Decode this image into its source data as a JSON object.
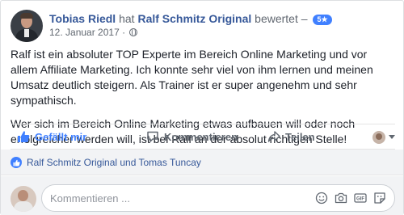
{
  "post": {
    "author": "Tobias Riedl",
    "verb": "hat",
    "page": "Ralf Schmitz Original",
    "action": "bewertet",
    "dash": "–",
    "rating": "5★",
    "date": "12. Januar 2017 ·",
    "privacy_icon": "globe-icon",
    "paragraph1": "Ralf ist ein absoluter TOP Experte im Bereich Online Marketing und vor allem Affiliate Marketing. Ich konnte sehr viel von ihm lernen und meinen Umsatz deutlich steigern. Als Trainer ist er super angenehm und sehr sympathisch.",
    "paragraph2": "Wer sich im Bereich Online Marketing etwas aufbauen will oder noch erfolgreicher werden will, ist bei Ralf an der absolut richtigen Stelle!"
  },
  "actions": {
    "like_label": "Gefällt mir",
    "comment_label": "Kommentieren",
    "share_label": "Teilen"
  },
  "reactions": {
    "text": "Ralf Schmitz Original und Tomas Tuncay"
  },
  "composer": {
    "placeholder": "Kommentieren ...",
    "value": ""
  },
  "colors": {
    "link": "#365899",
    "accent": "#4080ff",
    "muted": "#606770",
    "panel": "#f2f3f5"
  }
}
